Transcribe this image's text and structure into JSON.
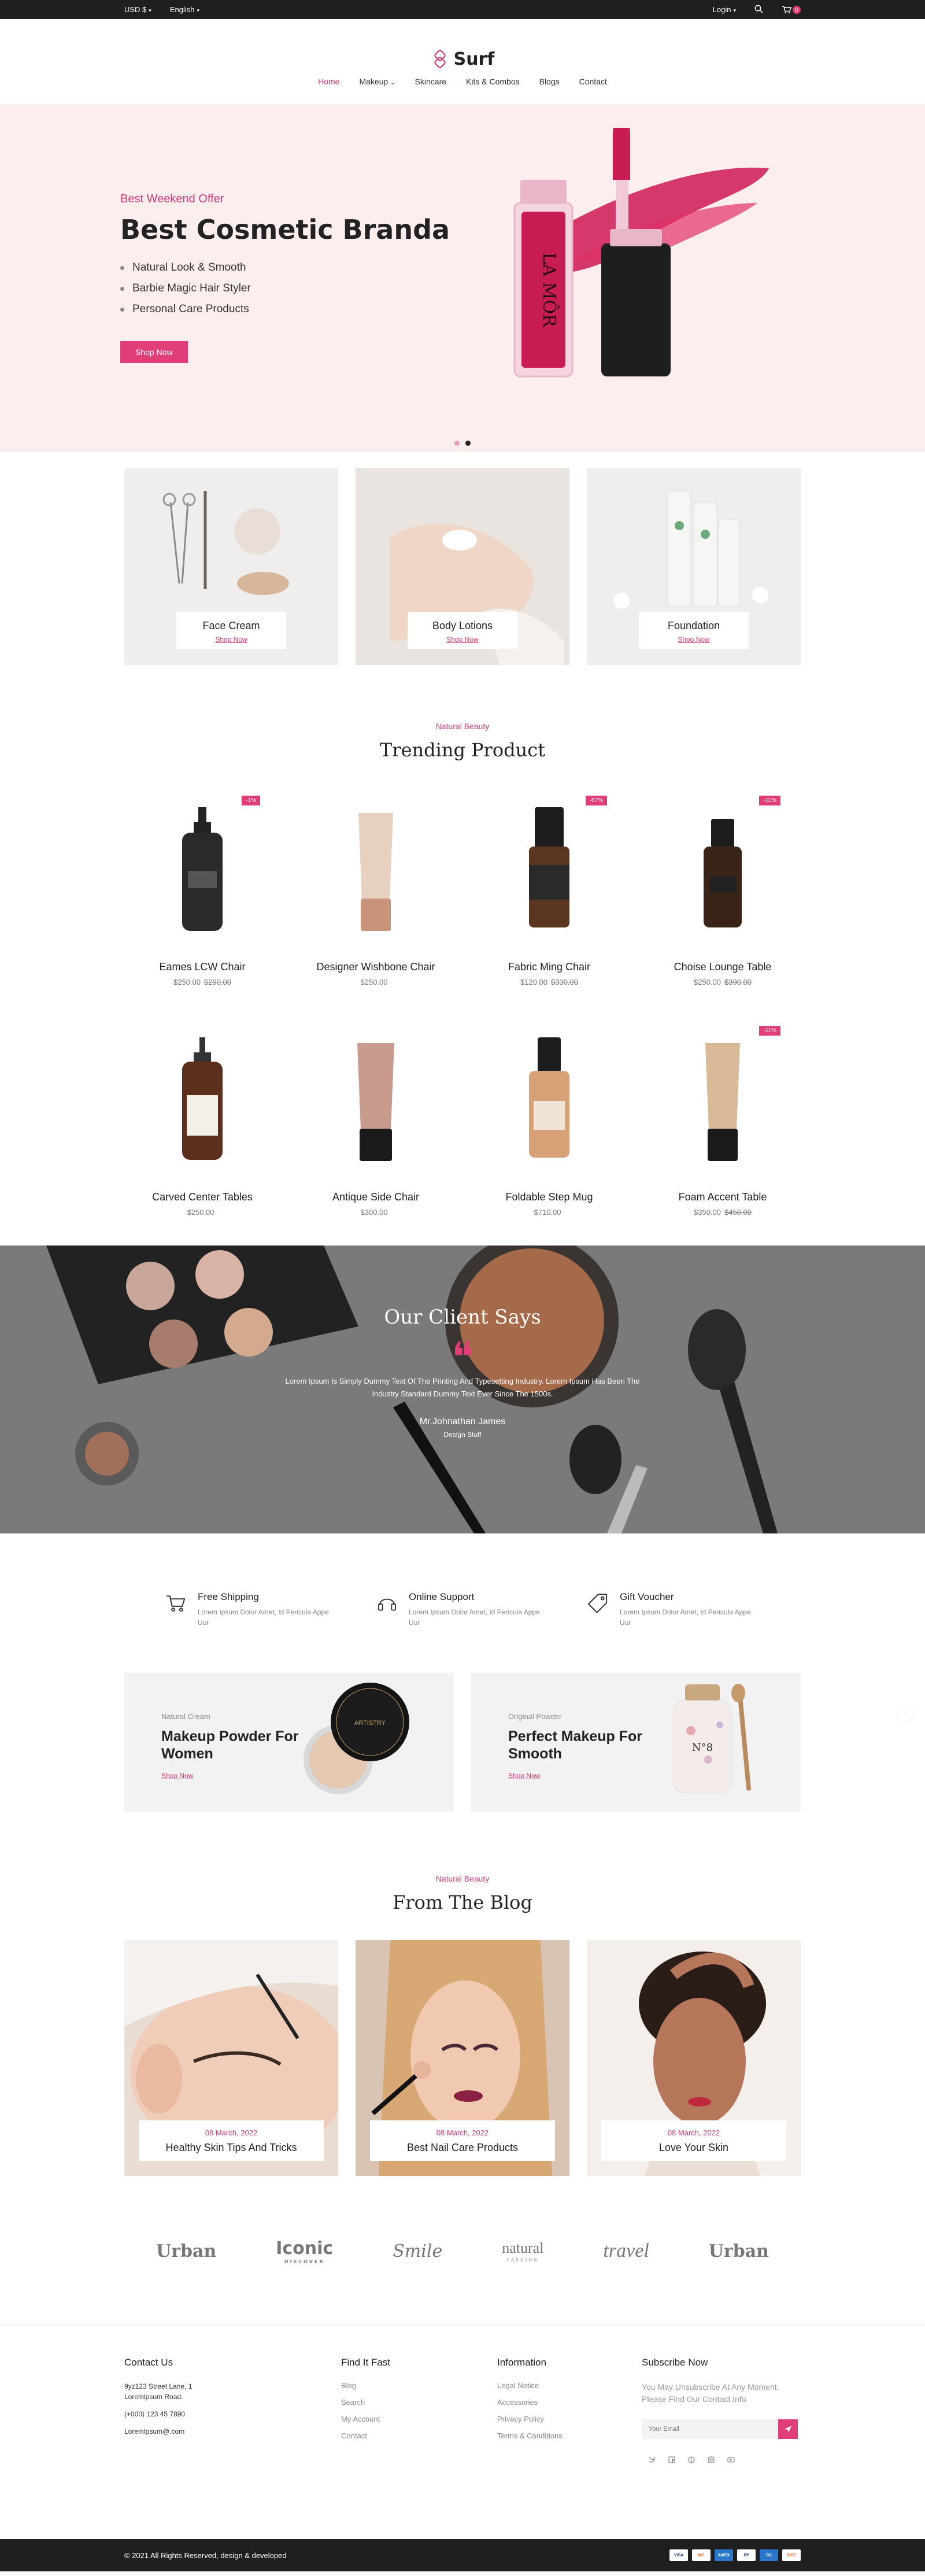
{
  "topbar": {
    "currency": "USD $",
    "language": "English",
    "login": "Login",
    "cart_count": "0"
  },
  "header": {
    "logo": "Surf",
    "nav": [
      "Home",
      "Makeup",
      "Skincare",
      "Kits & Combos",
      "Blogs",
      "Contact"
    ]
  },
  "hero": {
    "kicker": "Best Weekend Offer",
    "title": "Best Cosmetic Branda",
    "bullets": [
      "Natural Look & Smooth",
      "Barbie Magic Hair Styler",
      "Personal Care Products"
    ],
    "button": "Shop Now",
    "bottle_text": "LA MÔR"
  },
  "categories": [
    {
      "name": "Face Cream",
      "link": "Shop Now"
    },
    {
      "name": "Body Lotions",
      "link": "Shop Now"
    },
    {
      "name": "Foundation",
      "link": "Shop Now"
    }
  ],
  "trending": {
    "kicker": "Natural Beauty",
    "title": "Trending Product",
    "products": [
      {
        "name": "Eames LCW Chair",
        "price": "$250.00",
        "old": "$290.00",
        "badge": "-1%"
      },
      {
        "name": "Designer Wishbone Chair",
        "price": "$250.00",
        "old": "",
        "badge": ""
      },
      {
        "name": "Fabric Ming Chair",
        "price": "$120.00",
        "old": "$330.00",
        "badge": "-67%"
      },
      {
        "name": "Choise Lounge Table",
        "price": "$250.00",
        "old": "$390.00",
        "badge": "-11%"
      },
      {
        "name": "Carved Center Tables",
        "price": "$250.00",
        "old": "",
        "badge": ""
      },
      {
        "name": "Antique Side Chair",
        "price": "$300.00",
        "old": "",
        "badge": ""
      },
      {
        "name": "Foldable Step Mug",
        "price": "$710.00",
        "old": "",
        "badge": ""
      },
      {
        "name": "Foam Accent Table",
        "price": "$350.00",
        "old": "$450.00",
        "badge": "-11%"
      }
    ]
  },
  "testimonial": {
    "title": "Our Client Says",
    "quote_mark": "❝",
    "text": "Lorem Ipsum Is Simply Dummy Text Of The Printing And Typesetting Industry. Lorem Ipsum Has Been The Industry Standard Dummy Text Ever Since The 1500s.",
    "name": "Mr.Johnathan James",
    "role": "Design Stuff"
  },
  "features": [
    {
      "title": "Free Shipping",
      "desc": "Lorem Ipsum Dolor Amet, Id Pericula Appe Uur",
      "icon": "cart-icon"
    },
    {
      "title": "Online Support",
      "desc": "Lorem Ipsum Dolor Amet, Id Pericula Appe Uur",
      "icon": "headset-icon"
    },
    {
      "title": "Gift Voucher",
      "desc": "Lorem Ipsum Dolor Amet, Id Pericula Appe Uur",
      "icon": "tag-icon"
    }
  ],
  "banners": [
    {
      "kicker": "Natural Cream",
      "title": "Makeup Powder For Women",
      "link": "Shop Now",
      "label": "ARTISTRY"
    },
    {
      "kicker": "Original Powder",
      "title": "Perfect Makeup For Smooth",
      "link": "Shop Now",
      "label": "N°8"
    }
  ],
  "blog": {
    "kicker": "Natural Beauty",
    "title": "From The Blog",
    "posts": [
      {
        "date": "08 March, 2022",
        "title": "Healthy Skin Tips And Tricks"
      },
      {
        "date": "08 March, 2022",
        "title": "Best Nail Care Products"
      },
      {
        "date": "08 March, 2022",
        "title": "Love Your Skin"
      }
    ]
  },
  "brands": [
    {
      "name": "Urban",
      "sub": ""
    },
    {
      "name": "Iconic",
      "sub": "DISCOVER"
    },
    {
      "name": "Smile",
      "sub": ""
    },
    {
      "name": "natural",
      "sub": "FASHION"
    },
    {
      "name": "travel",
      "sub": ""
    },
    {
      "name": "Urban",
      "sub": ""
    }
  ],
  "footer": {
    "contact_title": "Contact Us",
    "contact_address": "9yz123 Street Lane, 1 Loremlpsum Road.",
    "contact_phone": "(+000) 123 45 7890",
    "contact_email": "Loremlpsum@.com",
    "find_title": "Find It Fast",
    "find_links": [
      "Blog",
      "Search",
      "My Account",
      "Contact"
    ],
    "info_title": "Information",
    "info_links": [
      "Legal Notice",
      "Accessories",
      "Privacy Policy",
      "Terms & Conditions"
    ],
    "subscribe_title": "Subscribe Now",
    "subscribe_text": "You May Unsubscribe At Any Moment. Please Find Our Contact Info",
    "email_placeholder": "Your Email",
    "copyright": "© 2021 All Rights Reserved, design & developed",
    "payments": [
      "VISA",
      "MC",
      "AMEX",
      "PP",
      "DC",
      "DISC"
    ]
  },
  "colors": {
    "accent": "#e13d79",
    "hero_bg": "#fdeeee",
    "dark": "#1f1f1f"
  }
}
